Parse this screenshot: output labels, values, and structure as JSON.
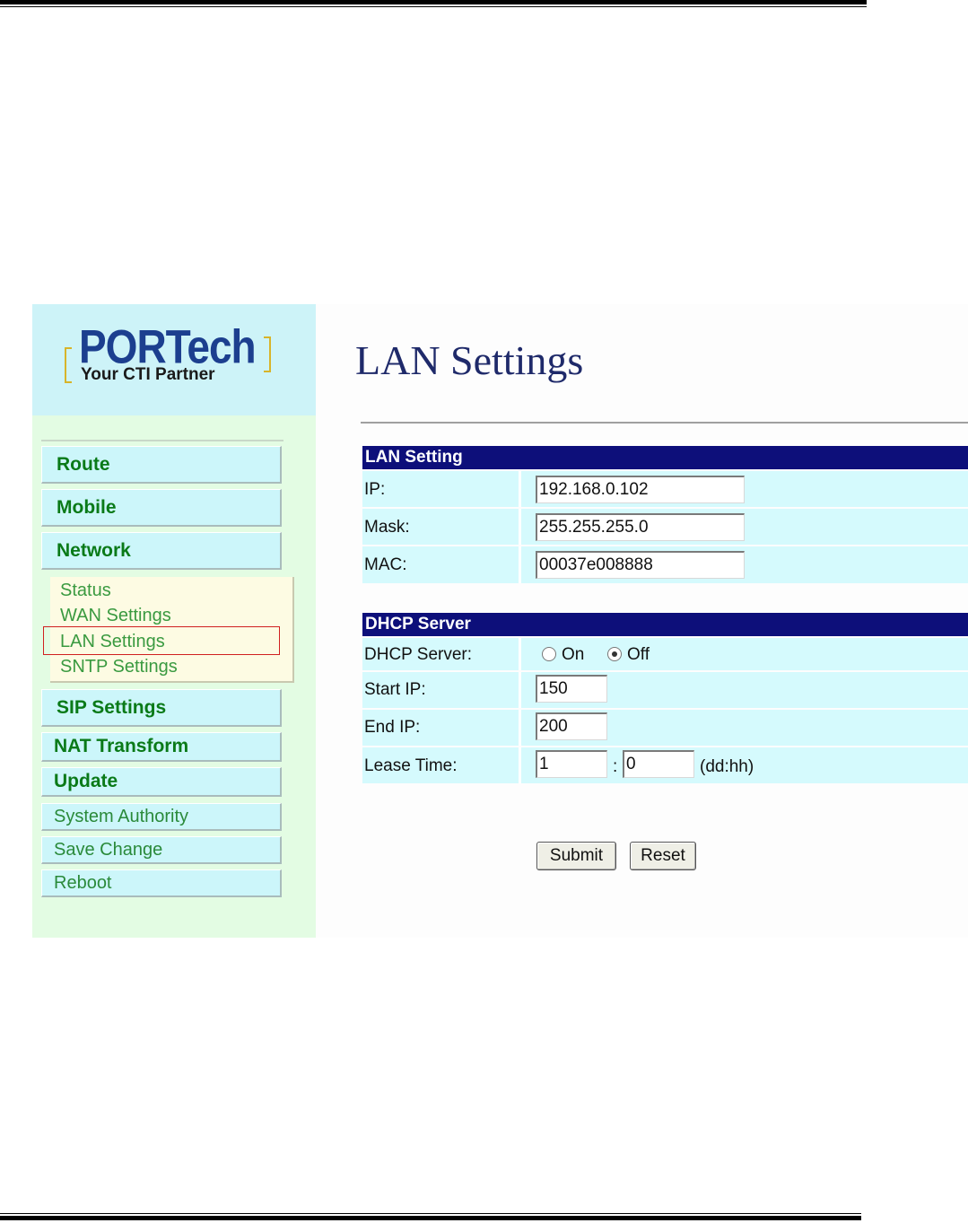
{
  "logo": {
    "name": "PORTech",
    "tagline": "Your CTI Partner"
  },
  "sidebar": {
    "menu": [
      {
        "label": "Route"
      },
      {
        "label": "Mobile"
      },
      {
        "label": "Network"
      }
    ],
    "submenu": [
      {
        "label": "Status"
      },
      {
        "label": "WAN Settings"
      },
      {
        "label": "LAN Settings"
      },
      {
        "label": "SNTP Settings"
      }
    ],
    "menu2": [
      {
        "label": "SIP Settings"
      },
      {
        "label": "NAT Transform"
      },
      {
        "label": "Update"
      },
      {
        "label": "System Authority"
      },
      {
        "label": "Save Change"
      },
      {
        "label": "Reboot"
      }
    ]
  },
  "main": {
    "title": "LAN Settings",
    "lan": {
      "header": "LAN Setting",
      "ip_label": "IP:",
      "ip_value": "192.168.0.102",
      "mask_label": "Mask:",
      "mask_value": "255.255.255.0",
      "mac_label": "MAC:",
      "mac_value": "00037e008888"
    },
    "dhcp": {
      "header": "DHCP Server",
      "server_label": "DHCP Server:",
      "on_label": "On",
      "off_label": "Off",
      "selected": "Off",
      "start_label": "Start IP:",
      "start_value": "150",
      "end_label": "End IP:",
      "end_value": "200",
      "lease_label": "Lease Time:",
      "lease_days": "1",
      "lease_sep": ":",
      "lease_hours": "0",
      "lease_unit": "(dd:hh)"
    },
    "buttons": {
      "submit": "Submit",
      "reset": "Reset"
    }
  },
  "colors": {
    "section_header": "#0d0f7a",
    "row_bg": "#d5fafd",
    "menu_text": "#0a7a18",
    "highlight": "#d02020"
  }
}
